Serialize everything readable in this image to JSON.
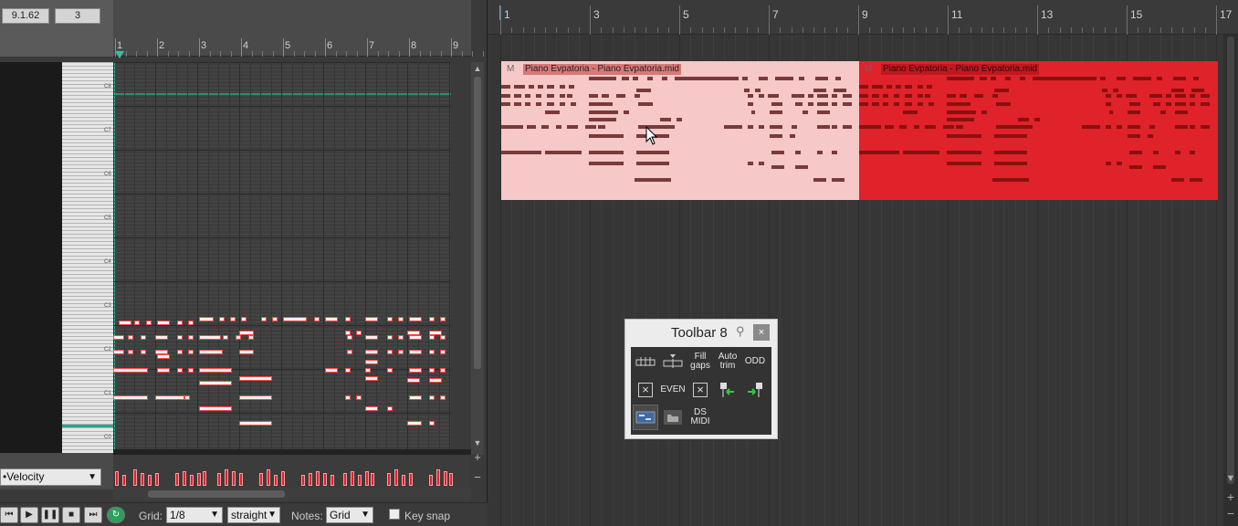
{
  "midi_editor": {
    "position_display": "9.1.62",
    "count_display": "3",
    "ruler_bars": [
      "1",
      "2",
      "3",
      "4",
      "5",
      "6",
      "7",
      "8",
      "9"
    ],
    "octave_labels": [
      "C8",
      "C7",
      "C6",
      "C5",
      "C4",
      "C3",
      "C2",
      "C1",
      "C0"
    ],
    "lane_selector": "•Velocity",
    "transport": {
      "grid_label": "Grid:",
      "grid_value": "1/8",
      "swing_value": "straight",
      "notes_label": "Notes:",
      "notes_value": "Grid",
      "keysnap_label": "Key snap"
    }
  },
  "arrange": {
    "ruler_bars": [
      "1",
      "3",
      "5",
      "7",
      "9",
      "11",
      "13",
      "15",
      "17"
    ],
    "items": [
      {
        "mute": "M",
        "title": "Piano Evpatoria - Piano Evpatoria.mid",
        "color": "#f6c8c8"
      },
      {
        "mute": "M",
        "title": "Piano Evpatoria - Piano Evpatoria.mid",
        "color": "#e0222a"
      }
    ]
  },
  "toolbar8": {
    "title": "Toolbar 8",
    "close": "×",
    "buttons": [
      {
        "name": "split-items-icon",
        "label": ""
      },
      {
        "name": "trim-items-icon",
        "label": ""
      },
      {
        "name": "fill-gaps",
        "label": "Fill gaps"
      },
      {
        "name": "auto-trim",
        "label": "Auto trim"
      },
      {
        "name": "odd",
        "label": "ODD"
      },
      {
        "name": "cancel-icon",
        "label": "×"
      },
      {
        "name": "even",
        "label": "EVEN"
      },
      {
        "name": "cancel-icon-2",
        "label": "×"
      },
      {
        "name": "marker-left-icon",
        "label": ""
      },
      {
        "name": "marker-right-icon",
        "label": ""
      },
      {
        "name": "midi-editor-icon",
        "label": ""
      },
      {
        "name": "folder-icon",
        "label": ""
      },
      {
        "name": "ds-midi",
        "label": "DS MIDI"
      }
    ]
  }
}
